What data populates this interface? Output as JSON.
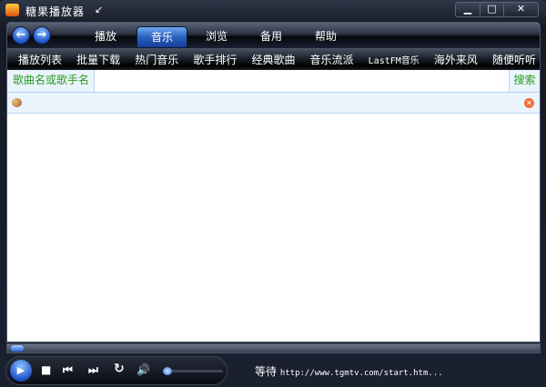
{
  "window": {
    "title": "糖果播放器",
    "mini_icon": "↙",
    "controls": {
      "minimize": "▁",
      "maximize": "□",
      "close": "✕"
    }
  },
  "nav": {
    "back": "←",
    "forward": "→",
    "tabs": [
      {
        "label": "播放"
      },
      {
        "label": "音乐",
        "active": true
      },
      {
        "label": "浏览"
      },
      {
        "label": "备用"
      },
      {
        "label": "帮助"
      }
    ]
  },
  "subnav": [
    "播放列表",
    "批量下载",
    "热门音乐",
    "歌手排行",
    "经典歌曲",
    "音乐流派",
    "LastFM音乐",
    "海外来风",
    "随便听听"
  ],
  "search": {
    "label": "歌曲名或歌手名",
    "value": "",
    "button": "搜索"
  },
  "player": {
    "play": "▶",
    "stop": "■",
    "prev": "⏮",
    "next": "⏭",
    "repeat": "↻",
    "volume": "🔊",
    "volume_level": 0,
    "progress": 0
  },
  "status": {
    "text": "等待",
    "url": "http://www.tgmtv.com/start.htm..."
  },
  "colors": {
    "accent": "#2a60c0",
    "search_text": "#2a9a20"
  }
}
